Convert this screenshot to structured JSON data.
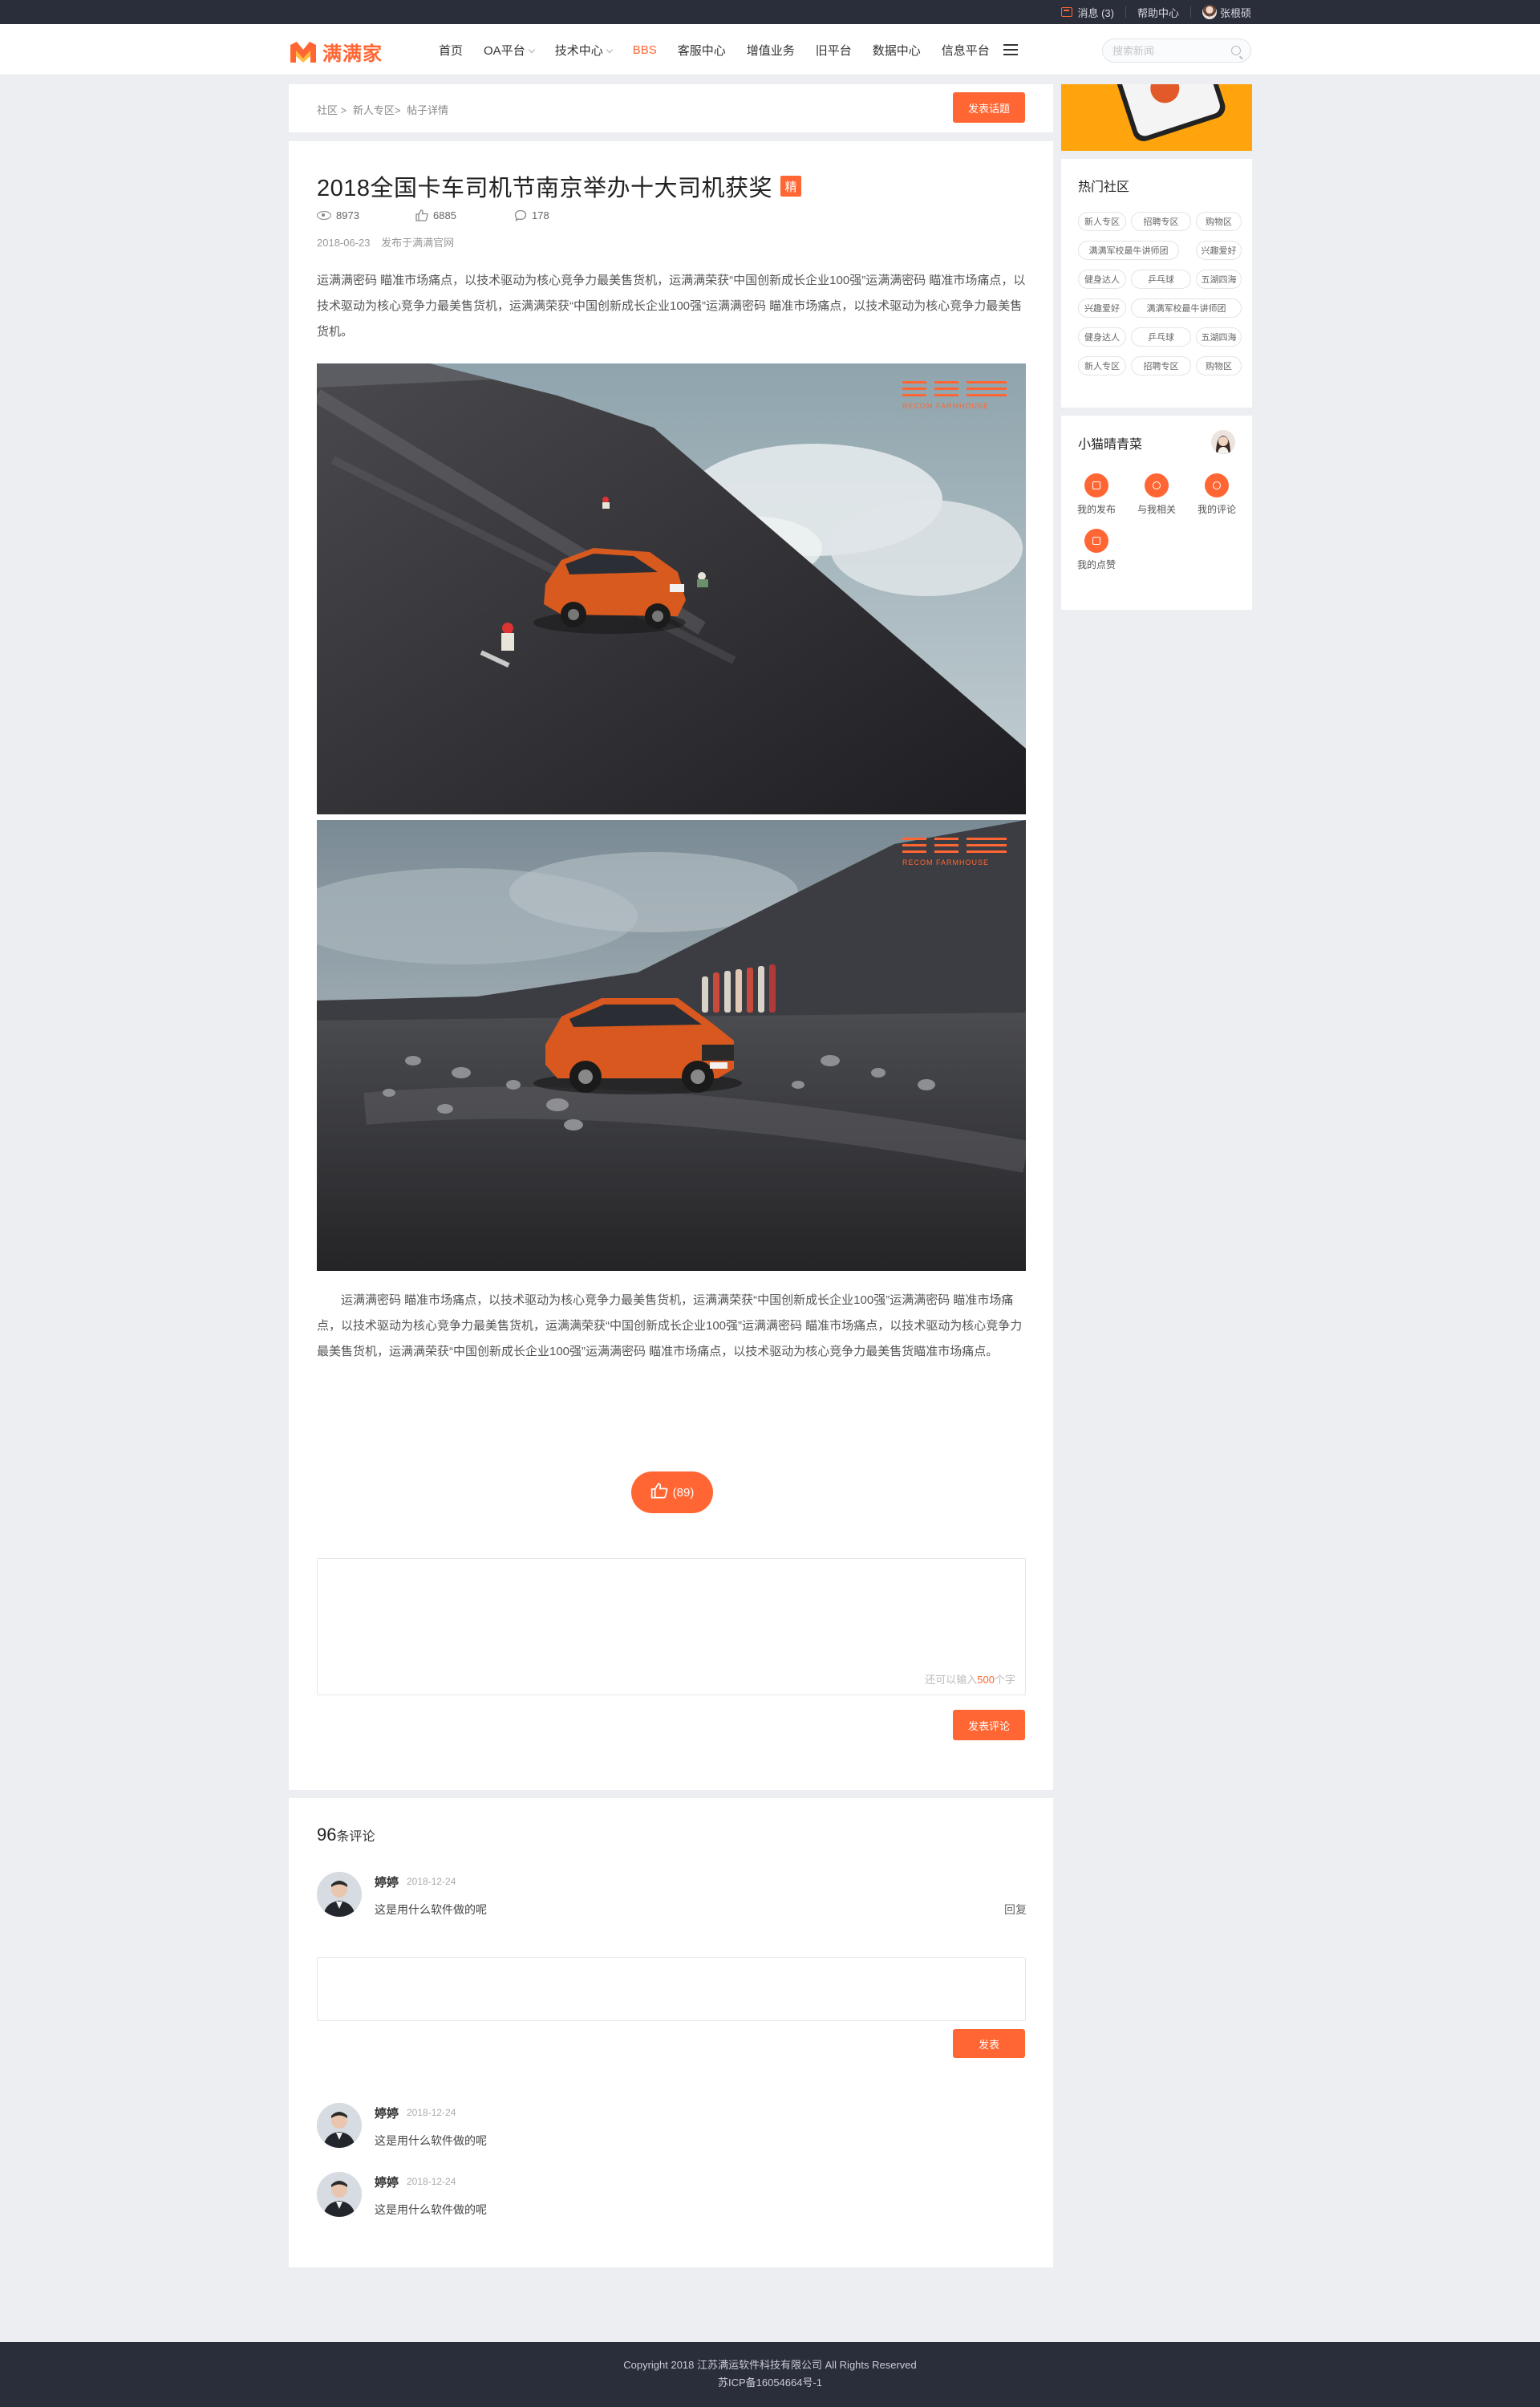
{
  "topbar": {
    "messages": "消息 (3)",
    "help": "帮助中心",
    "username": "张根硕"
  },
  "header": {
    "logo_text": "满满家",
    "nav": [
      {
        "label": "首页"
      },
      {
        "label": "OA平台",
        "dropdown": true
      },
      {
        "label": "技术中心",
        "dropdown": true
      },
      {
        "label": "BBS",
        "active": true
      },
      {
        "label": "客服中心"
      },
      {
        "label": "增值业务"
      },
      {
        "label": "旧平台"
      },
      {
        "label": "数据中心"
      },
      {
        "label": "信息平台"
      }
    ],
    "search_placeholder": "搜索新闻"
  },
  "breadcrumb": {
    "items": [
      "社区 >",
      "新人专区>",
      "帖子详情"
    ],
    "post_topic_label": "发表话题"
  },
  "article": {
    "title": "2018全国卡车司机节南京举办十大司机获奖",
    "badge": "精",
    "views": "8973",
    "likes": "6885",
    "comments": "178",
    "date": "2018-06-23",
    "publisher": "发布于满满官网",
    "intro": "运满满密码 瞄准市场痛点，以技术驱动为核心竞争力最美售货机，运满满荣获“中国创新成长企业100强”运满满密码 瞄准市场痛点，以技术驱动为核心竞争力最美售货机，运满满荣获“中国创新成长企业100强”运满满密码 瞄准市场痛点，以技术驱动为核心竞争力最美售货机。",
    "watermark": "RECOM FARMHOUSE",
    "body": "运满满密码 瞄准市场痛点，以技术驱动为核心竞争力最美售货机，运满满荣获“中国创新成长企业100强”运满满密码 瞄准市场痛点，以技术驱动为核心竞争力最美售货机，运满满荣获“中国创新成长企业100强”运满满密码 瞄准市场痛点，以技术驱动为核心竞争力最美售货机，运满满荣获“中国创新成长企业100强”运满满密码 瞄准市场痛点，以技术驱动为核心竞争力最美售货瞄准市场痛点。",
    "like_count": "(89)",
    "char_hint_prefix": "还可以输入",
    "char_hint_num": "500",
    "char_hint_suffix": "个字",
    "post_comment_label": "发表评论"
  },
  "comments": {
    "count": "96",
    "count_suffix": "条评论",
    "reply_label": "回复",
    "send_label": "发表",
    "items": [
      {
        "name": "婷婷",
        "date": "2018-12-24",
        "text": "这是用什么软件做的呢"
      },
      {
        "name": "婷婷",
        "date": "2018-12-24",
        "text": "这是用什么软件做的呢"
      },
      {
        "name": "婷婷",
        "date": "2018-12-24",
        "text": "这是用什么软件做的呢"
      }
    ]
  },
  "sidebar": {
    "hot_title": "热门社区",
    "tags": [
      "新人专区",
      "招聘专区",
      "购物区",
      "满满军校最牛讲师团",
      "兴趣爱好",
      "健身达人",
      "乒乓球",
      "五湖四海",
      "兴趣爱好",
      "满满军校最牛讲师团",
      "健身达人",
      "乒乓球",
      "五湖四海",
      "新人专区",
      "招聘专区",
      "购物区"
    ],
    "user_name": "小猫晴青菜",
    "shortcuts": [
      {
        "label": "我的发布",
        "icon": "publish-icon"
      },
      {
        "label": "与我相关",
        "icon": "related-icon"
      },
      {
        "label": "我的评论",
        "icon": "comment-icon"
      },
      {
        "label": "我的点赞",
        "icon": "like-icon"
      }
    ]
  },
  "footer": {
    "line1": "Copyright 2018 江苏满运软件科技有限公司 All Rights Reserved",
    "line2": "苏ICP备16054664号-1"
  },
  "colors": {
    "accent": "#ff6633",
    "dark": "#2a2d3a",
    "page_bg": "#eceef1"
  }
}
